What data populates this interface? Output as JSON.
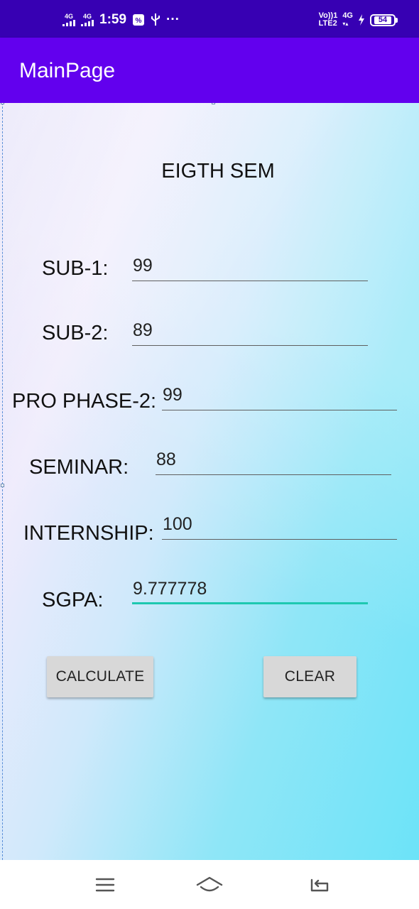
{
  "status_bar": {
    "net1": "4G",
    "net2": "4G",
    "time": "1:59",
    "volte": "Vo))1",
    "lte": "LTE2",
    "net3": "4G",
    "battery": "54",
    "icons": [
      "signal-icon",
      "data-saver-icon",
      "usb-icon",
      "more-icon",
      "charging-icon",
      "battery-icon"
    ]
  },
  "app_bar": {
    "title": "MainPage"
  },
  "form": {
    "heading": "EIGTH SEM",
    "fields": [
      {
        "label": "SUB-1:",
        "value": "99"
      },
      {
        "label": "SUB-2:",
        "value": "89"
      },
      {
        "label": "PRO PHASE-2:",
        "value": "99"
      },
      {
        "label": "SEMINAR:",
        "value": "88"
      },
      {
        "label": "INTERNSHIP:",
        "value": "100"
      },
      {
        "label": "SGPA:",
        "value": "9.777778"
      }
    ],
    "calculate_label": "CALCULATE",
    "clear_label": "CLEAR"
  },
  "colors": {
    "status_bar": "#3700b3",
    "app_bar": "#6200ee",
    "focus_underline": "#1ec8b0",
    "button": "#d8d8d8"
  },
  "nav_bar": {
    "icons": [
      "menu-icon",
      "home-icon",
      "back-icon"
    ]
  }
}
